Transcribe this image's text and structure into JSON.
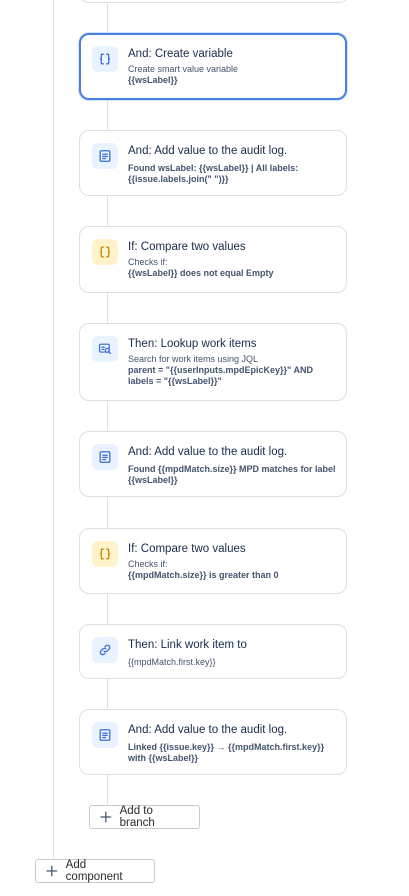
{
  "cards": [
    {
      "title": "And: Create variable",
      "sub": "Create smart value variable",
      "detail": "{{wsLabel}}",
      "detail_bold": true,
      "icon": "braces-icon",
      "color": "blue",
      "selected": true
    },
    {
      "title": "And: Add value to the audit log.",
      "sub": "",
      "detail": "Found wsLabel: {{wsLabel}} | All labels: {{issue.labels.join(\" \")}}",
      "detail_bold": true,
      "icon": "document-icon",
      "color": "blue"
    },
    {
      "title": "If: Compare two values",
      "sub": "Checks if:",
      "detail": "{{wsLabel}} does not equal Empty",
      "detail_bold": true,
      "icon": "braces-icon",
      "color": "yellow"
    },
    {
      "title": "Then: Lookup work items",
      "sub": "Search for work items using JQL",
      "detail": "parent = \"{{userInputs.mpdEpicKey}}\" AND labels = \"{{wsLabel}}\"",
      "detail_bold": true,
      "icon": "search-list-icon",
      "color": "blue"
    },
    {
      "title": "And: Add value to the audit log.",
      "sub": "",
      "detail": "Found {{mpdMatch.size}} MPD matches for label {{wsLabel}}",
      "detail_bold": true,
      "icon": "document-icon",
      "color": "blue"
    },
    {
      "title": "If: Compare two values",
      "sub": "Checks if:",
      "detail": "{{mpdMatch.size}} is greater than 0",
      "detail_bold": true,
      "icon": "braces-icon",
      "color": "yellow"
    },
    {
      "title": "Then: Link work item to",
      "sub": "",
      "detail": "{{mpdMatch.first.key}}",
      "detail_bold": false,
      "icon": "link-icon",
      "color": "blue"
    },
    {
      "title": "And: Add value to the audit log.",
      "sub": "",
      "detail": "Linked {{issue.key}} → {{mpdMatch.first.key}} with {{wsLabel}}",
      "detail_bold": true,
      "icon": "document-icon",
      "color": "blue"
    }
  ],
  "add_to_branch": "Add to branch",
  "add_component": "Add component",
  "colors": {
    "accent": "#4b7fe0",
    "icon_blue_bg": "#e9f2ff",
    "icon_yellow_bg": "#fff3c9",
    "border": "#dcdfe4"
  }
}
